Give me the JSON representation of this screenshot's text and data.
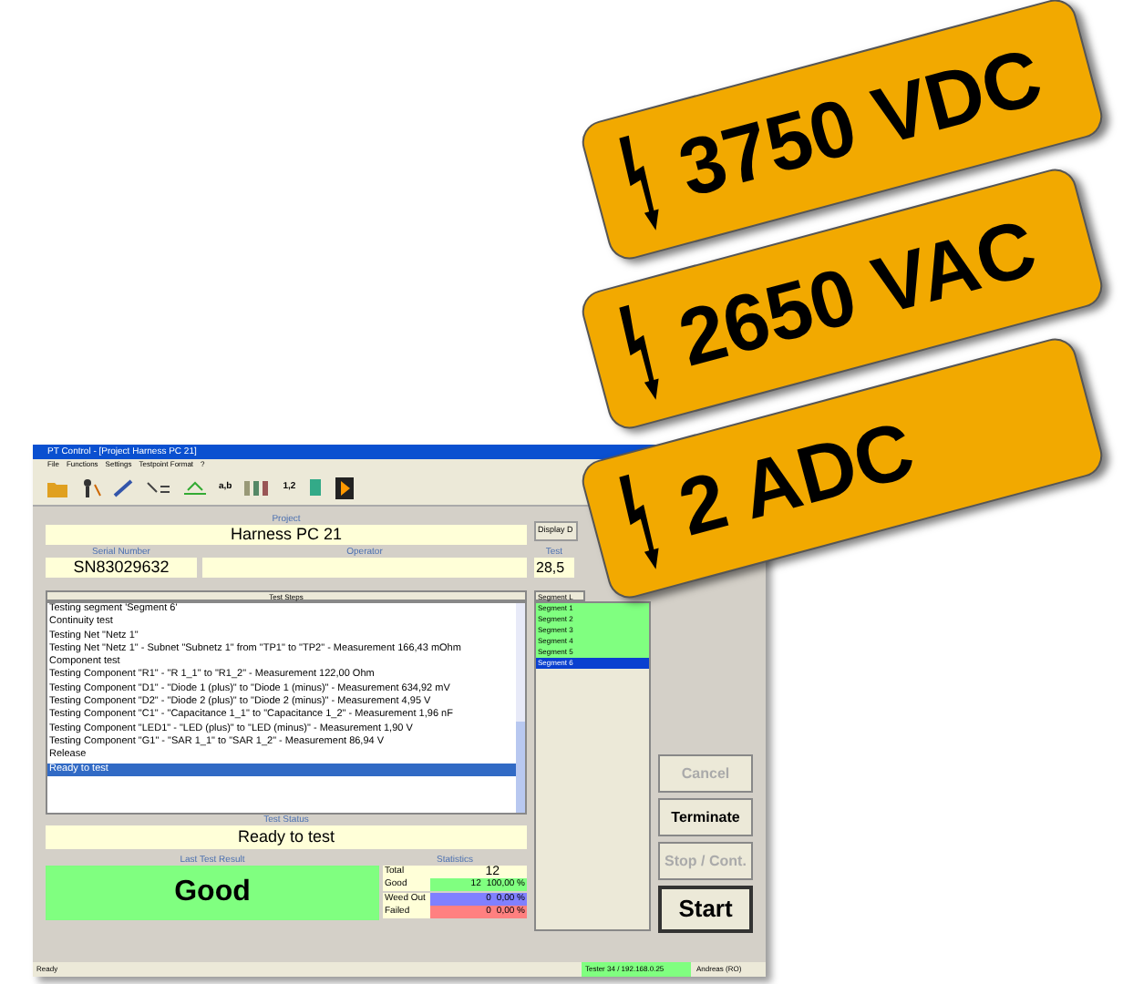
{
  "window": {
    "title": "PT Control - [Project Harness PC 21]"
  },
  "menu": [
    "File",
    "Functions",
    "Settings",
    "Testpoint Format",
    "?"
  ],
  "toolbar": {
    "texts": [
      "a,b",
      "1,2"
    ]
  },
  "project": {
    "label": "Project",
    "value": "Harness PC 21"
  },
  "display_button": "Display D",
  "serial": {
    "label": "Serial Number",
    "value": "SN83029632"
  },
  "operator": {
    "label": "Operator"
  },
  "test_time": {
    "label": "Test",
    "value": "28,5"
  },
  "test_steps": {
    "title": "Test Steps",
    "items": [
      {
        "text": "Testing segment 'Segment 6'",
        "selected": false
      },
      {
        "text": "Continuity test",
        "selected": false
      },
      {
        "text": "Testing Net \"Netz 1\"",
        "selected": false
      },
      {
        "text": "Testing Net \"Netz 1\" - Subnet \"Subnetz 1\" from \"TP1\" to \"TP2\" - Measurement 166,43 mOhm",
        "selected": false
      },
      {
        "text": "Component test",
        "selected": false
      },
      {
        "text": "Testing Component \"R1\" - \"R 1_1\" to \"R1_2\" - Measurement 122,00 Ohm",
        "selected": false
      },
      {
        "text": "Testing Component \"D1\" - \"Diode 1 (plus)\" to \"Diode 1 (minus)\" - Measurement 634,92 mV",
        "selected": false
      },
      {
        "text": "Testing Component \"D2\" - \"Diode 2 (plus)\" to \"Diode 2 (minus)\" - Measurement 4,95 V",
        "selected": false
      },
      {
        "text": "Testing Component \"C1\" - \"Capacitance 1_1\" to \"Capacitance 1_2\" - Measurement 1,96 nF",
        "selected": false
      },
      {
        "text": "Testing Component \"LED1\" - \"LED (plus)\" to \"LED (minus)\" - Measurement 1,90 V",
        "selected": false
      },
      {
        "text": "Testing Component \"G1\" - \"SAR 1_1\" to \"SAR 1_2\" - Measurement 86,94 V",
        "selected": false
      },
      {
        "text": "Release",
        "selected": false
      },
      {
        "text": "Ready to test",
        "selected": true
      }
    ]
  },
  "segments": {
    "title": "Segment L",
    "items": [
      {
        "text": "Segment 1",
        "selected": false
      },
      {
        "text": "Segment 2",
        "selected": false
      },
      {
        "text": "Segment 3",
        "selected": false
      },
      {
        "text": "Segment 4",
        "selected": false
      },
      {
        "text": "Segment 5",
        "selected": false
      },
      {
        "text": "Segment 6",
        "selected": true
      }
    ]
  },
  "test_status": {
    "label": "Test Status",
    "value": "Ready to test"
  },
  "last_result": {
    "label": "Last Test Result",
    "value": "Good"
  },
  "statistics": {
    "title": "Statistics",
    "rows": [
      {
        "label": "Total",
        "count": "12"
      },
      {
        "label": "Good",
        "count": "12",
        "percent": "100,00 %",
        "color": "#80ff80"
      },
      {
        "label": "Weed Out",
        "count": "0",
        "percent": "0,00 %",
        "color": "#8080ff"
      },
      {
        "label": "Failed",
        "count": "0",
        "percent": "0,00 %",
        "color": "#ff8080"
      }
    ]
  },
  "buttons": [
    {
      "label": "Cancel",
      "disabled": true,
      "kind": "normal"
    },
    {
      "label": "Terminate",
      "disabled": false,
      "kind": "normal"
    },
    {
      "label": "Stop / Cont.",
      "disabled": true,
      "kind": "normal"
    },
    {
      "label": "Start",
      "disabled": false,
      "kind": "default"
    }
  ],
  "status_bar": [
    "Ready",
    "Tester 34 / 192.168.0.25",
    "Andreas (RO)"
  ],
  "labels": [
    "3750 VDC",
    "2650 VAC",
    "2 ADC"
  ]
}
